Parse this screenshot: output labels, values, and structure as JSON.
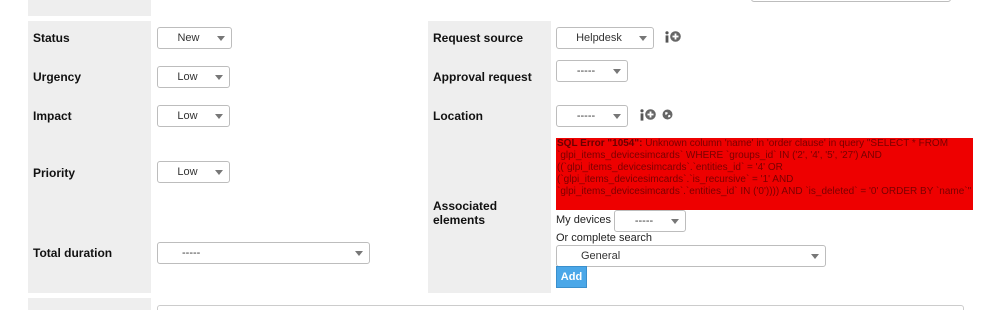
{
  "fields": {
    "status": {
      "label": "Status",
      "value": "New"
    },
    "urgency": {
      "label": "Urgency",
      "value": "Low"
    },
    "impact": {
      "label": "Impact",
      "value": "Low"
    },
    "priority": {
      "label": "Priority",
      "value": "Low"
    },
    "total_duration": {
      "label": "Total duration",
      "value": "-----"
    },
    "request_source": {
      "label": "Request source",
      "value": "Helpdesk"
    },
    "approval_request": {
      "label": "Approval request",
      "value": "-----"
    },
    "location": {
      "label": "Location",
      "value": "-----"
    },
    "associated_elements": {
      "label_line1": "Associated",
      "label_line2": "elements",
      "error": {
        "title": "SQL Error \"1054\":",
        "message": " Unknown column 'name' in 'order clause' in query \"SELECT * FROM `glpi_items_devicesimcards` WHERE `groups_id` IN ('2', '4', '5', '27') AND ((`glpi_items_devicesimcards`.`entities_id` = '4' OR (`glpi_items_devicesimcards`.`is_recursive` = '1' AND `glpi_items_devicesimcards`.`entities_id` IN ('0')))) AND `is_deleted` = '0' ORDER BY `name`\""
      },
      "my_devices_label": "My devices",
      "my_devices_value": "-----",
      "complete_search_label": "Or complete search",
      "complete_search_value": "General",
      "add_button": "Add"
    }
  },
  "colors": {
    "label_bg": "#eeeeee",
    "error_bg": "#ee0000",
    "button_bg": "#4aa7e8"
  },
  "icons": [
    "info-icon",
    "add-icon",
    "globe-icon"
  ]
}
